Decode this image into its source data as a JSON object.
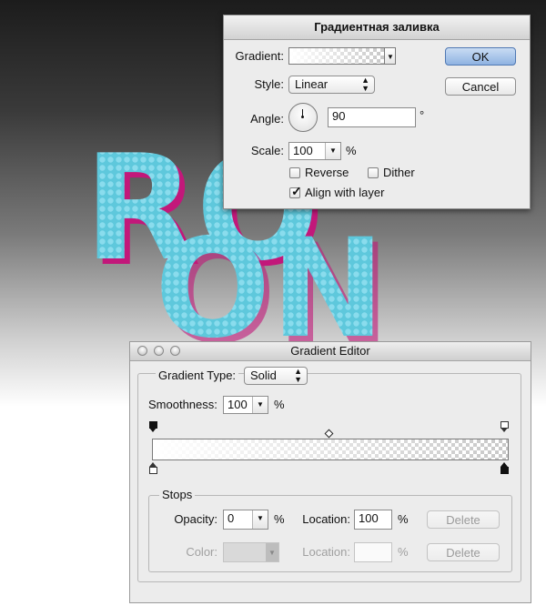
{
  "background_art": {
    "text_line1": "RO",
    "text_line2": "ON"
  },
  "fill_dialog": {
    "title": "Градиентная заливка",
    "gradient_label": "Gradient:",
    "style_label": "Style:",
    "style_value": "Linear",
    "angle_label": "Angle:",
    "angle_value": "90",
    "angle_unit": "°",
    "scale_label": "Scale:",
    "scale_value": "100",
    "scale_unit": "%",
    "reverse_label": "Reverse",
    "reverse_checked": false,
    "dither_label": "Dither",
    "dither_checked": false,
    "align_label": "Align with layer",
    "align_checked": true,
    "ok_label": "OK",
    "cancel_label": "Cancel"
  },
  "gradient_editor": {
    "title": "Gradient Editor",
    "type_label": "Gradient Type:",
    "type_value": "Solid",
    "smoothness_label": "Smoothness:",
    "smoothness_value": "100",
    "smoothness_unit": "%",
    "stops_group_label": "Stops",
    "opacity_label": "Opacity:",
    "opacity_value": "0",
    "opacity_unit": "%",
    "location_label": "Location:",
    "location_value": "100",
    "location_unit": "%",
    "delete_label": "Delete",
    "color_label": "Color:",
    "color_location_label": "Location:",
    "color_location_value": "",
    "color_location_unit": "%",
    "color_delete_label": "Delete"
  },
  "colors": {
    "accent": "#8fb3e2",
    "art_cyan": "#5ec8dc",
    "art_magenta": "#c2187a"
  }
}
